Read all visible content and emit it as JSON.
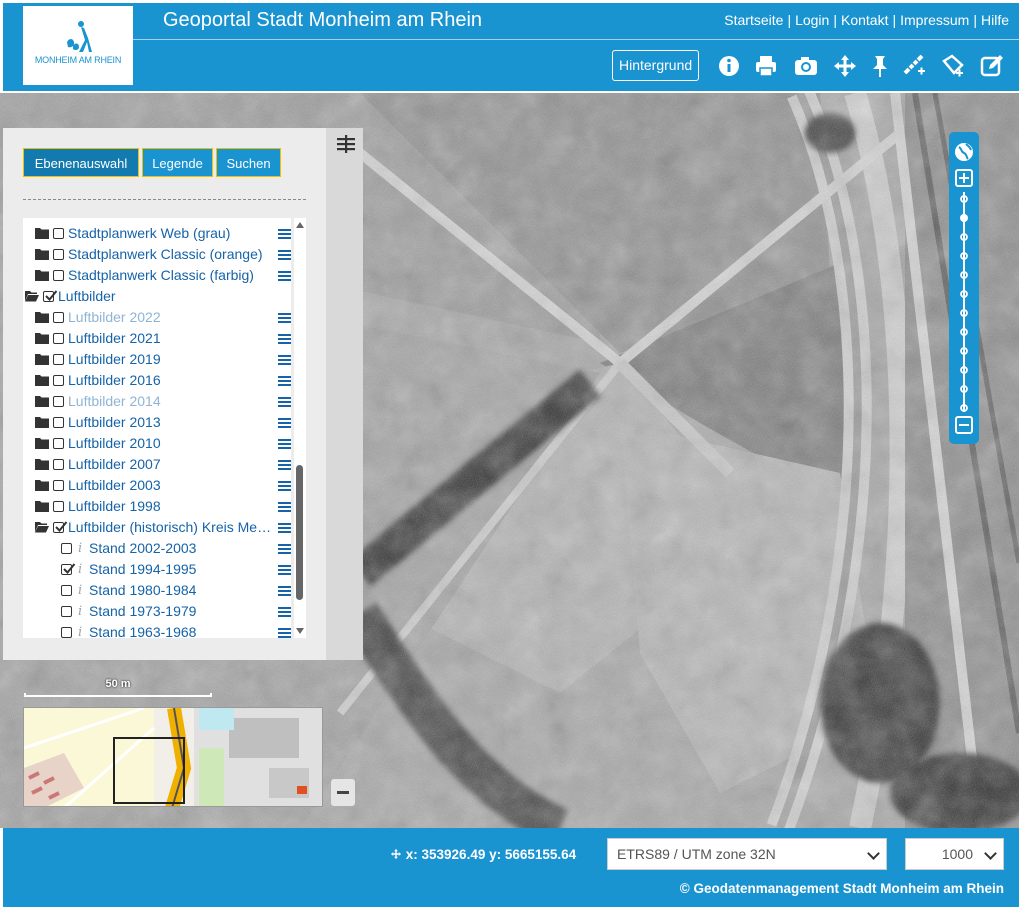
{
  "header": {
    "title": "Geoportal Stadt Monheim am Rhein",
    "logo_text": "MONHEIM AM RHEIN",
    "links": [
      "Startseite",
      "Login",
      "Kontakt",
      "Impressum",
      "Hilfe"
    ],
    "separator": "|",
    "background_button": "Hintergrund",
    "tools": [
      "info-icon",
      "print-icon",
      "camera-icon",
      "move-icon",
      "pin-icon",
      "measure-line-icon",
      "measure-area-icon",
      "edit-icon"
    ]
  },
  "panel": {
    "tabs": [
      "Ebenenauswahl",
      "Legende",
      "Suchen"
    ],
    "layers": [
      {
        "label": "Stadtplanwerk Web (grau)",
        "checked": false,
        "type": "folder"
      },
      {
        "label": "Stadtplanwerk Classic (orange)",
        "checked": false,
        "type": "folder"
      },
      {
        "label": "Stadtplanwerk Classic (farbig)",
        "checked": false,
        "type": "folder"
      },
      {
        "label": "Luftbilder",
        "checked": true,
        "type": "folder-open"
      },
      {
        "label": "Luftbilder 2022",
        "checked": false,
        "type": "folder",
        "dim": true
      },
      {
        "label": "Luftbilder 2021",
        "checked": false,
        "type": "folder"
      },
      {
        "label": "Luftbilder 2019",
        "checked": false,
        "type": "folder"
      },
      {
        "label": "Luftbilder 2016",
        "checked": false,
        "type": "folder"
      },
      {
        "label": "Luftbilder 2014",
        "checked": false,
        "type": "folder",
        "dim": true
      },
      {
        "label": "Luftbilder 2013",
        "checked": false,
        "type": "folder"
      },
      {
        "label": "Luftbilder 2010",
        "checked": false,
        "type": "folder"
      },
      {
        "label": "Luftbilder 2007",
        "checked": false,
        "type": "folder"
      },
      {
        "label": "Luftbilder 2003",
        "checked": false,
        "type": "folder"
      },
      {
        "label": "Luftbilder 1998",
        "checked": false,
        "type": "folder"
      },
      {
        "label": "Luftbilder (historisch) Kreis Mettmann",
        "checked": true,
        "type": "folder-open"
      },
      {
        "label": "Stand 2002-2003",
        "checked": false,
        "type": "leaf"
      },
      {
        "label": "Stand 1994-1995",
        "checked": true,
        "type": "leaf"
      },
      {
        "label": "Stand 1980-1984",
        "checked": false,
        "type": "leaf"
      },
      {
        "label": "Stand 1973-1979",
        "checked": false,
        "type": "leaf"
      },
      {
        "label": "Stand 1963-1968",
        "checked": false,
        "type": "leaf"
      }
    ]
  },
  "map": {
    "scale_label": "50 m"
  },
  "footer": {
    "coords": "x: 353926.49 y: 5665155.64",
    "crs": "ETRS89 / UTM zone 32N",
    "scale": "1000",
    "copyright": "© Geodatenmanagement Stadt Monheim am Rhein"
  },
  "colors": {
    "brand": "#1a93d1",
    "link": "#1563a8"
  }
}
